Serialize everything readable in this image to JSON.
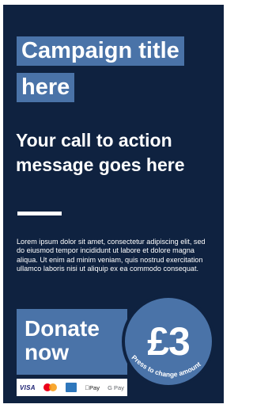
{
  "campaign": {
    "title_line_1": "Campaign title",
    "title_line_2": "here"
  },
  "cta": {
    "message": "Your call to action message goes here"
  },
  "body": {
    "text": "Lorem ipsum dolor sit amet, consectetur adipiscing elit, sed do eiusmod tempor incididunt ut labore et dolore magna aliqua. Ut enim ad minim veniam, quis nostrud exercitation ullamco laboris nisi ut aliquip ex ea commodo consequat."
  },
  "donate": {
    "label_line_1": "Donate",
    "label_line_2": "now",
    "amount": "£3",
    "hint": "Press to change amount"
  },
  "payment_methods": [
    {
      "name": "visa-icon",
      "label": "VISA"
    },
    {
      "name": "mastercard-icon",
      "label": ""
    },
    {
      "name": "amex-icon",
      "label": ""
    },
    {
      "name": "apple-pay-icon",
      "label": " Pay"
    },
    {
      "name": "google-pay-icon",
      "label": "G Pay"
    }
  ],
  "colors": {
    "background": "#0f2240",
    "accent": "#4a73a8",
    "text": "#ffffff"
  }
}
